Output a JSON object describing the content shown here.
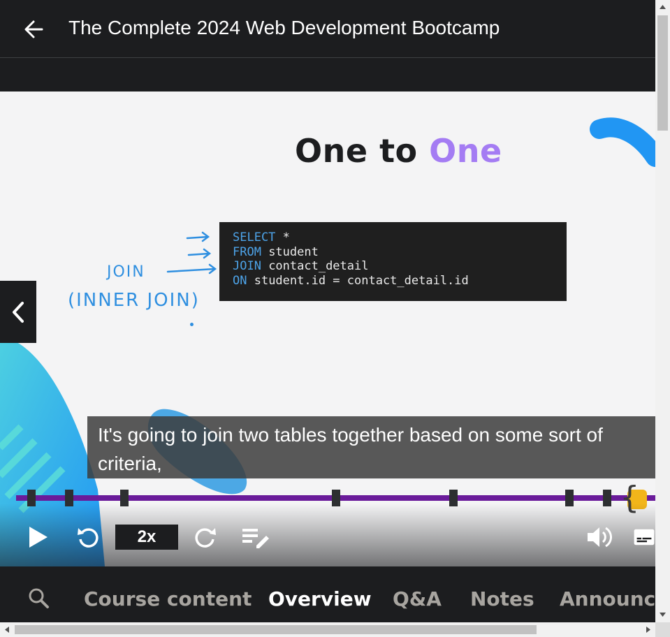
{
  "header": {
    "title": "The Complete 2024 Web Development Bootcamp"
  },
  "slide": {
    "title_part1": "One to ",
    "title_part2": "One",
    "code": [
      {
        "kw": "SELECT",
        "rest": " *"
      },
      {
        "kw": "FROM",
        "rest": " student"
      },
      {
        "kw": "JOIN",
        "rest": " contact_detail"
      },
      {
        "kw": "ON",
        "rest": " student.id = contact_detail.id"
      }
    ],
    "annotation_1": "JOIN",
    "annotation_2": "(INNER JOIN)"
  },
  "caption": {
    "text": "It's going to join two tables together based on some sort of criteria,"
  },
  "player": {
    "speed": "2x",
    "accent_color": "#6a1b9a"
  },
  "tabs": [
    {
      "label": "Course content",
      "active": false
    },
    {
      "label": "Overview",
      "active": true
    },
    {
      "label": "Q&A",
      "active": false
    },
    {
      "label": "Notes",
      "active": false
    },
    {
      "label": "Announce",
      "active": false
    }
  ],
  "colors": {
    "background": "#1c1d1f",
    "slide_accent": "#a47cf3",
    "code_keyword": "#4da3e8",
    "annotation": "#2f8fe0"
  }
}
